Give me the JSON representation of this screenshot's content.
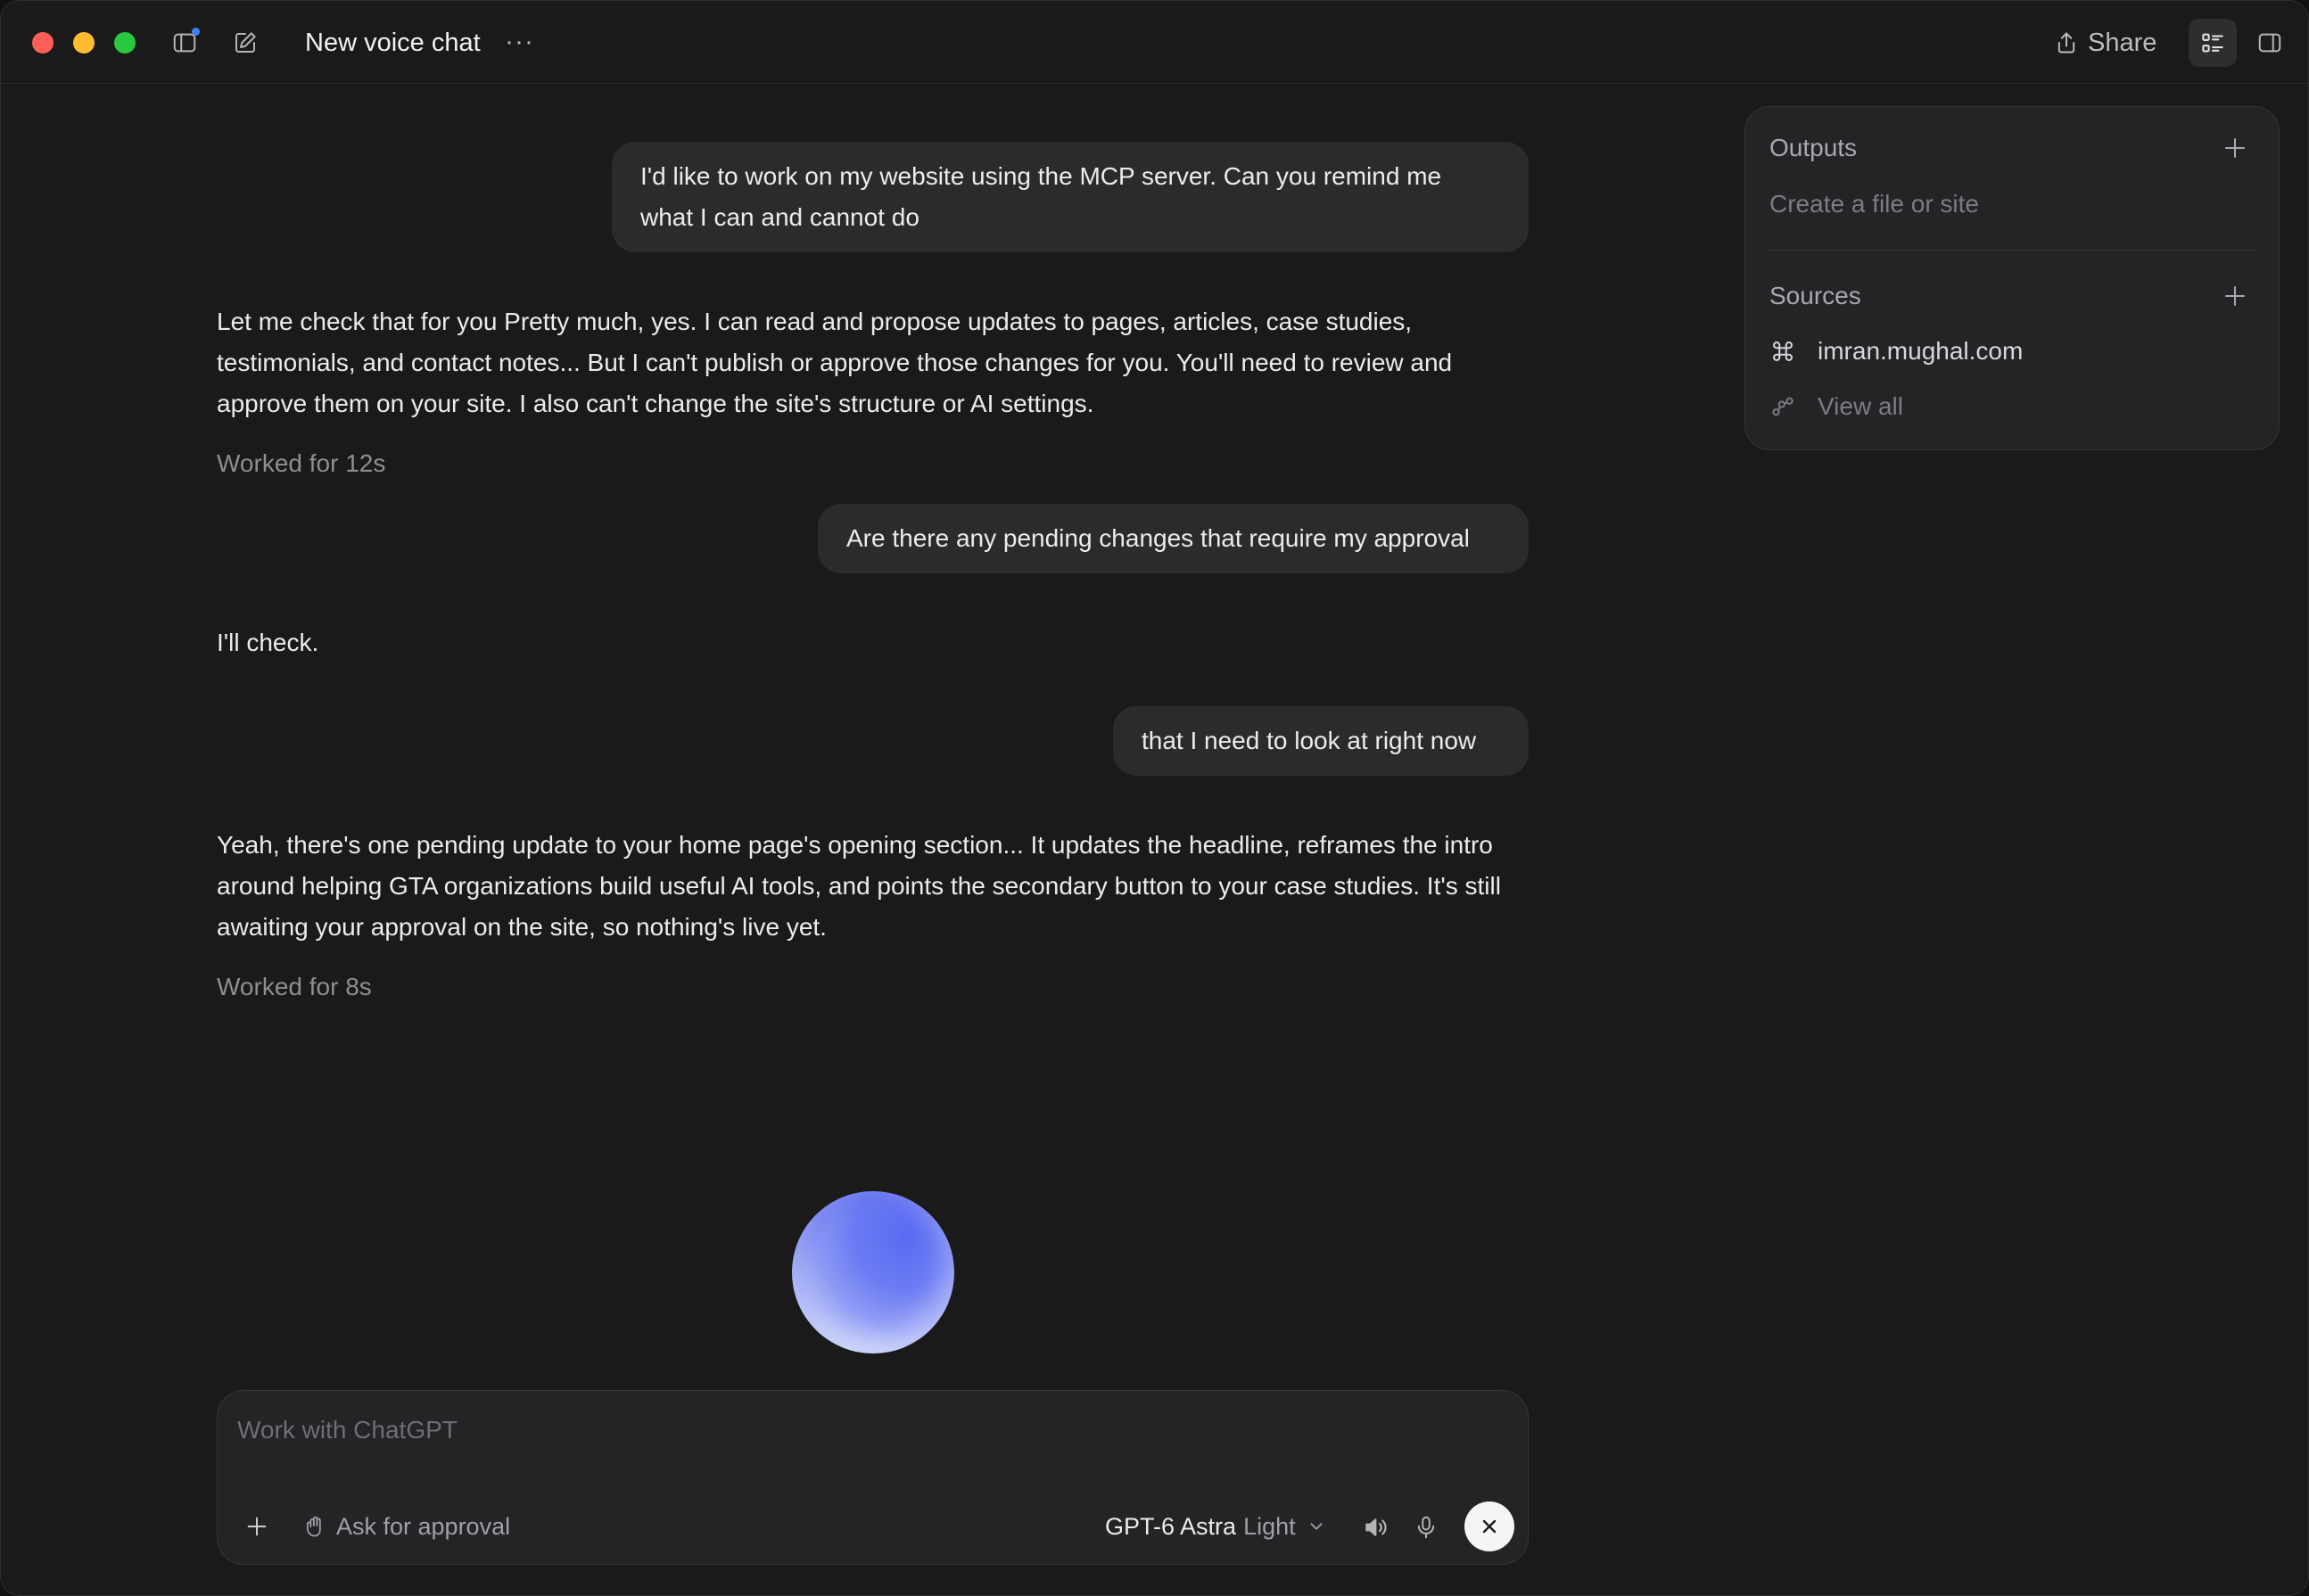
{
  "window": {
    "title": "New voice chat",
    "more_label": "···",
    "share_label": "Share"
  },
  "conversation": {
    "messages": [
      {
        "role": "user",
        "text": "I'd like to work on my website using the MCP server. Can you remind me what I can and cannot do"
      },
      {
        "role": "assistant",
        "text": "Let me check that for you Pretty much, yes. I can read and propose updates to pages, articles, case studies, testimonials, and contact notes... But I can't publish or approve those changes for you. You'll need to review and approve them on your site. I also can't change the site's structure or AI settings.",
        "worked": "Worked for 12s"
      },
      {
        "role": "user",
        "text": "Are there any pending changes that require my approval"
      },
      {
        "role": "assistant",
        "text": "I'll check."
      },
      {
        "role": "user",
        "text": "that I need to look at right now"
      },
      {
        "role": "assistant",
        "text": "Yeah, there's one pending update to your home page's opening section... It updates the headline, reframes the intro around helping GTA organizations build useful AI tools, and points the secondary button to your case studies. It's still awaiting your approval on the site, so nothing's live yet.",
        "worked": "Worked for 8s"
      }
    ]
  },
  "composer": {
    "placeholder": "Work with ChatGPT",
    "value": "",
    "approval_label": "Ask for approval",
    "model_name": "GPT-6 Astra",
    "model_variant": "Light"
  },
  "side_panel": {
    "outputs_heading": "Outputs",
    "outputs_empty": "Create a file or site",
    "sources_heading": "Sources",
    "sources": [
      {
        "label": "imran.mughal.com",
        "icon": "command-icon"
      }
    ],
    "view_all_label": "View all"
  },
  "colors": {
    "background": "#1A1A1B",
    "bubble": "#2B2B2D",
    "panel": "#242426",
    "accent_blue": "#3B82F6",
    "orb": "#6C7BF4"
  }
}
